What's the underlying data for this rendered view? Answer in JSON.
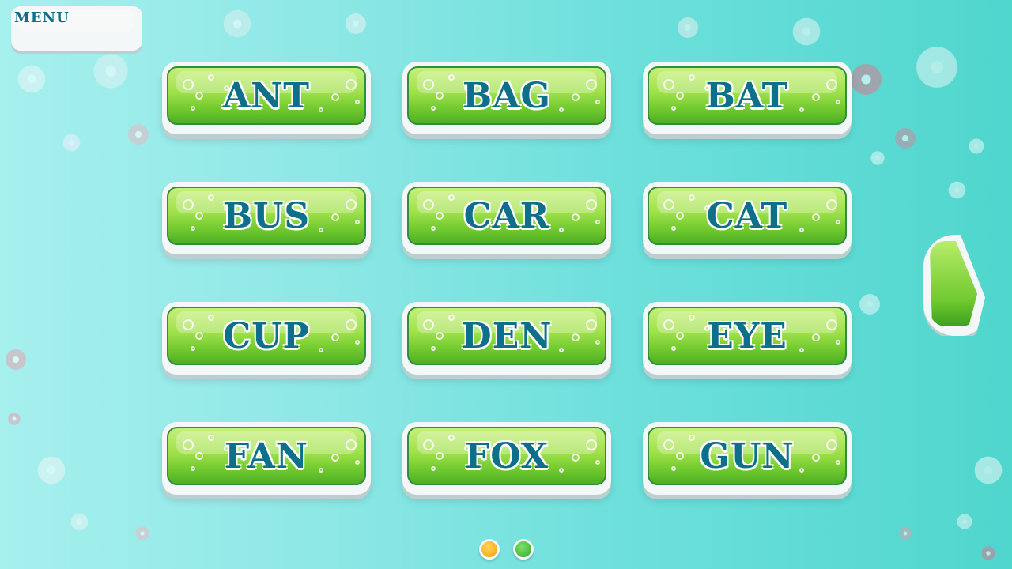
{
  "menu": {
    "label": "MENU"
  },
  "words": [
    "ANT",
    "BAG",
    "BAT",
    "BUS",
    "CAR",
    "CAT",
    "CUP",
    "DEN",
    "EYE",
    "FAN",
    "FOX",
    "GUN"
  ],
  "pagination": {
    "pages": 2,
    "current": 1,
    "active_color": "#f5a400",
    "inactive_color": "#3cbf3a"
  },
  "next": {
    "icon": "next-arrow-icon"
  },
  "colors": {
    "word_text": "#0e6f8a",
    "button_green": "#8ed83e",
    "background": "#6fe0dc"
  }
}
